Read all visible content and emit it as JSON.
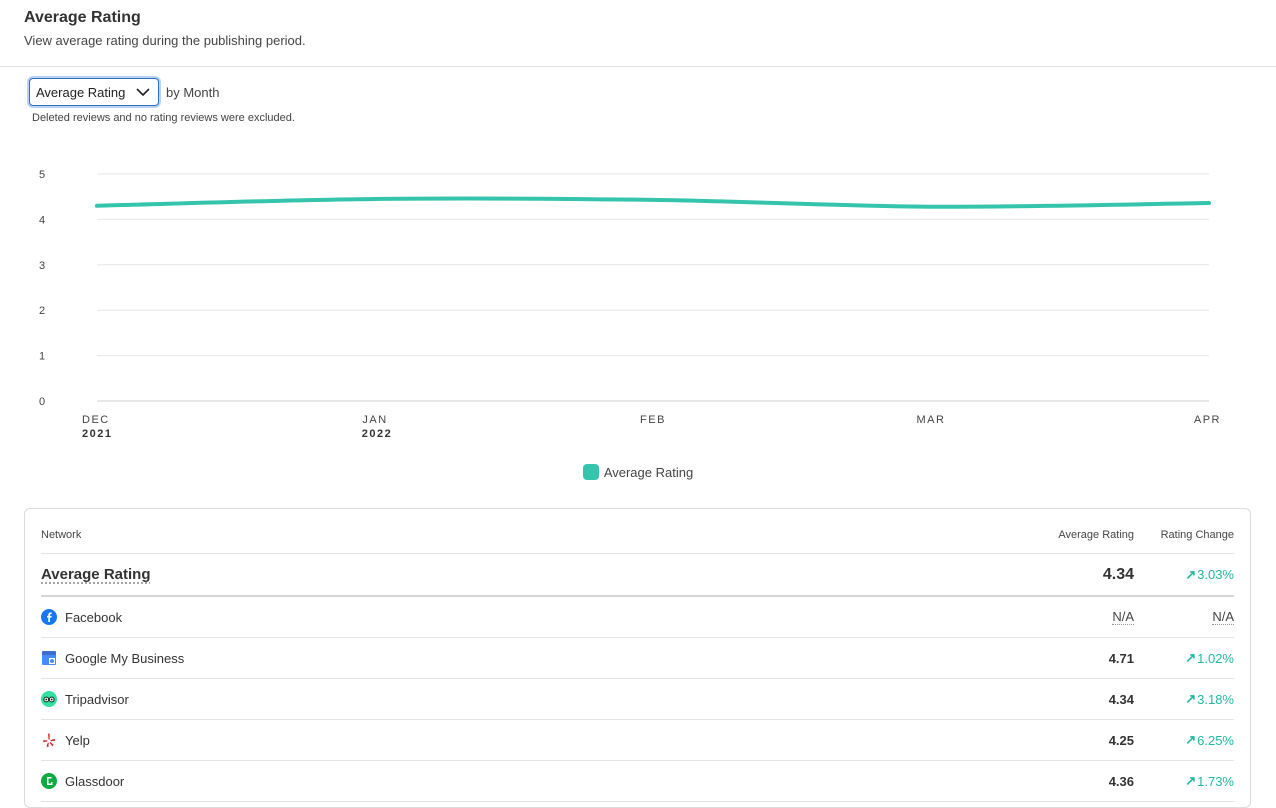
{
  "header": {
    "title": "Average Rating",
    "subtitle": "View average rating during the publishing period."
  },
  "controls": {
    "select_value": "Average Rating",
    "by_label": "by Month",
    "note": "Deleted reviews and no rating reviews were excluded."
  },
  "colors": {
    "series": "#33c4ab",
    "accent_up": "#20b8a0",
    "focus": "#2c6ecb"
  },
  "chart_data": {
    "type": "line",
    "x_months": [
      "DEC",
      "JAN",
      "FEB",
      "MAR",
      "APR"
    ],
    "x_years": [
      "2021",
      "2022",
      "",
      "",
      ""
    ],
    "series": [
      {
        "name": "Average Rating",
        "values": [
          4.3,
          4.45,
          4.43,
          4.28,
          4.36
        ]
      }
    ],
    "yticks": [
      "0",
      "1",
      "2",
      "3",
      "4",
      "5"
    ],
    "ylim": [
      0,
      5
    ],
    "grid": true,
    "legend": "bottom-center"
  },
  "table": {
    "headers": {
      "network": "Network",
      "avg": "Average Rating",
      "change": "Rating Change"
    },
    "summary": {
      "name": "Average Rating",
      "avg": "4.34",
      "change": "3.03%"
    },
    "rows": [
      {
        "icon": "facebook-icon",
        "name": "Facebook",
        "avg": "N/A",
        "change": "N/A",
        "up": false
      },
      {
        "icon": "google-my-business-icon",
        "name": "Google My Business",
        "avg": "4.71",
        "change": "1.02%",
        "up": true
      },
      {
        "icon": "tripadvisor-icon",
        "name": "Tripadvisor",
        "avg": "4.34",
        "change": "3.18%",
        "up": true
      },
      {
        "icon": "yelp-icon",
        "name": "Yelp",
        "avg": "4.25",
        "change": "6.25%",
        "up": true
      },
      {
        "icon": "glassdoor-icon",
        "name": "Glassdoor",
        "avg": "4.36",
        "change": "1.73%",
        "up": true
      }
    ]
  }
}
